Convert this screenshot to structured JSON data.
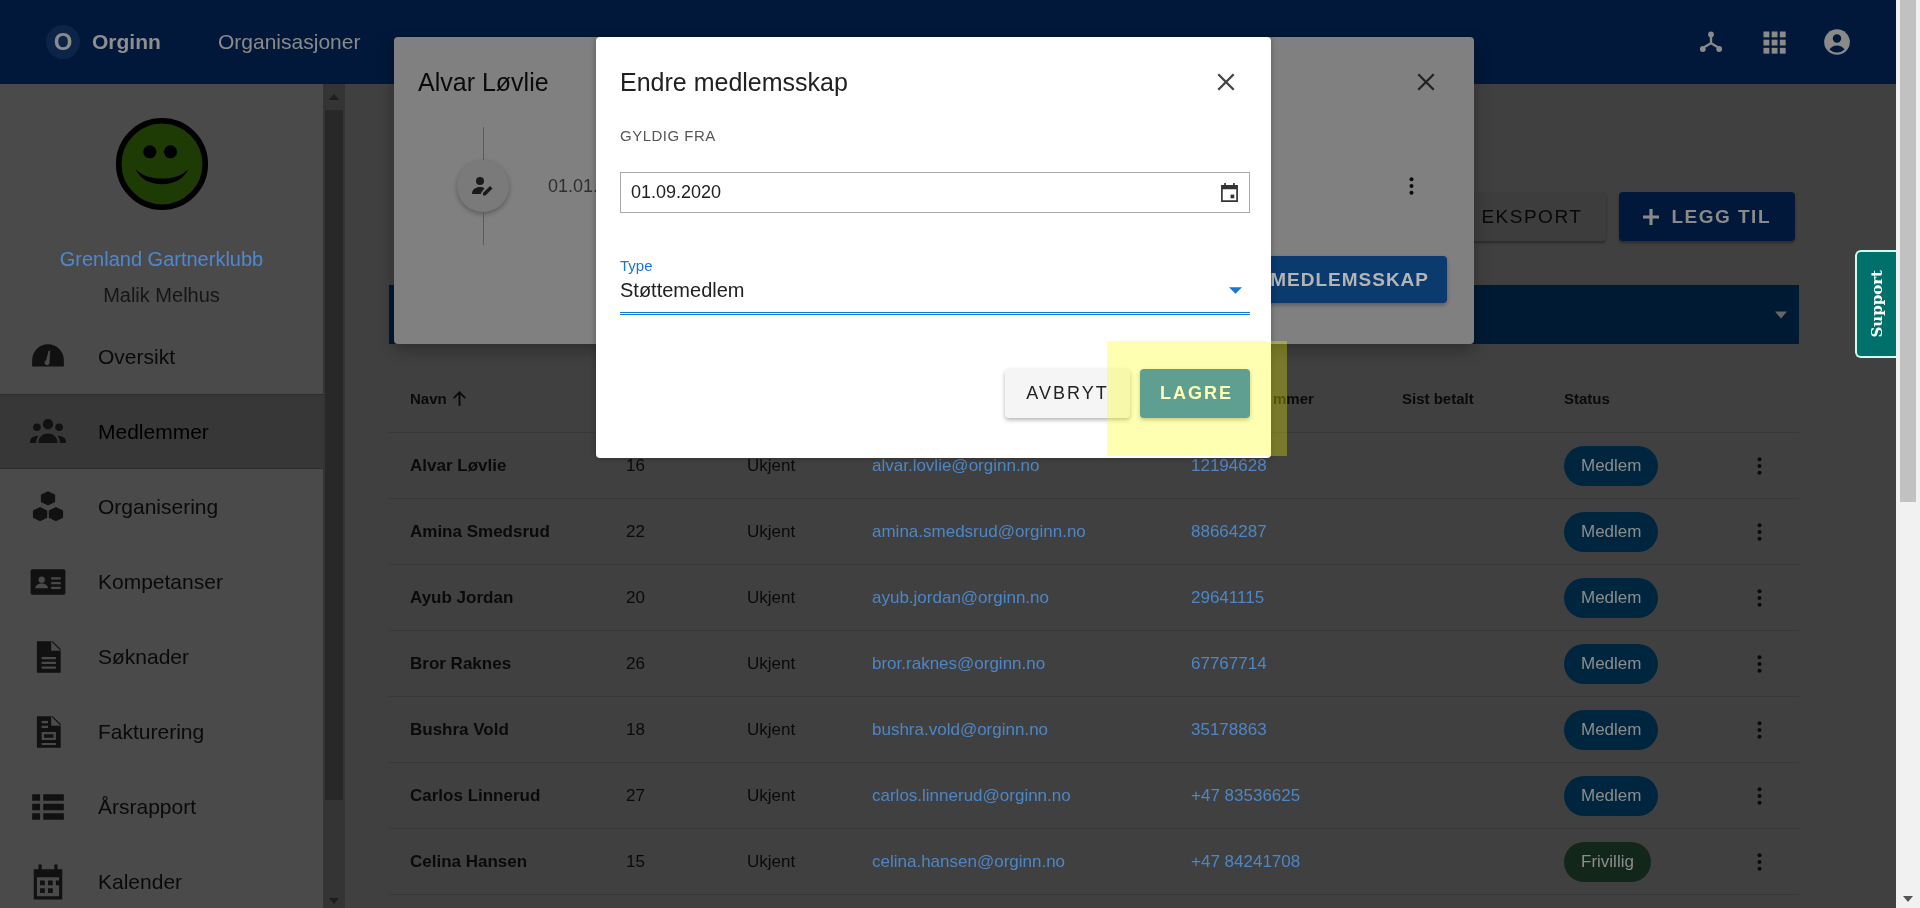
{
  "topbar": {
    "logo_letter": "O",
    "brand": "Orginn",
    "nav": [
      {
        "label": "Organisasjoner"
      }
    ]
  },
  "sidebar": {
    "organization": "Grenland Gartnerklubb",
    "user": "Malik Melhus",
    "items": [
      {
        "label": "Oversikt",
        "selected": false
      },
      {
        "label": "Medlemmer",
        "selected": true
      },
      {
        "label": "Organisering",
        "selected": false
      },
      {
        "label": "Kompetanser",
        "selected": false
      },
      {
        "label": "Søknader",
        "selected": false
      },
      {
        "label": "Fakturering",
        "selected": false
      },
      {
        "label": "Årsrapport",
        "selected": false
      },
      {
        "label": "Kalender",
        "selected": false
      }
    ]
  },
  "actions": [
    {
      "label": "EKSPORT",
      "kind": "plain"
    },
    {
      "label": "LEGG TIL",
      "kind": "add"
    }
  ],
  "table": {
    "columns": {
      "name": {
        "label": "Navn"
      },
      "phone": {
        "label": "mmer"
      },
      "paid": {
        "label": "Sist betalt"
      },
      "status": {
        "label": "Status"
      }
    },
    "rows": [
      {
        "name": "Alvar Løvlie",
        "column_2": "16",
        "column_3": "Ukjent",
        "email": "alvar.lovlie@orginn.no",
        "phone": "12194628",
        "status": {
          "label": "Medlem",
          "color": "#00263f"
        }
      },
      {
        "name": "Amina Smedsrud",
        "column_2": "22",
        "column_3": "Ukjent",
        "email": "amina.smedsrud@orginn.no",
        "phone": "88664287",
        "status": {
          "label": "Medlem",
          "color": "#00263f"
        }
      },
      {
        "name": "Ayub Jordan",
        "column_2": "20",
        "column_3": "Ukjent",
        "email": "ayub.jordan@orginn.no",
        "phone": "29641115",
        "status": {
          "label": "Medlem",
          "color": "#00263f"
        }
      },
      {
        "name": "Bror Raknes",
        "column_2": "26",
        "column_3": "Ukjent",
        "email": "bror.raknes@orginn.no",
        "phone": "67767714",
        "status": {
          "label": "Medlem",
          "color": "#00263f"
        }
      },
      {
        "name": "Bushra Vold",
        "column_2": "18",
        "column_3": "Ukjent",
        "email": "bushra.vold@orginn.no",
        "phone": "35178863",
        "status": {
          "label": "Medlem",
          "color": "#00263f"
        }
      },
      {
        "name": "Carlos Linnerud",
        "column_2": "27",
        "column_3": "Ukjent",
        "email": "carlos.linnerud@orginn.no",
        "phone": "+47 83536625",
        "status": {
          "label": "Medlem",
          "color": "#00263f"
        }
      },
      {
        "name": "Celina Hansen",
        "column_2": "15",
        "column_3": "Ukjent",
        "email": "celina.hansen@orginn.no",
        "phone": "+47 84241708",
        "status": {
          "label": "Frivillig",
          "color": "#13261a"
        }
      }
    ]
  },
  "member_dialog": {
    "title": "Alvar Løvlie",
    "timeline": [
      {
        "date": "01.01."
      }
    ],
    "action": "MEDLEMSSKAP"
  },
  "edit_dialog": {
    "title": "Endre medlemsskap",
    "section_label": "GYLDIG FRA",
    "date_field": {
      "value": "01.09.2020"
    },
    "type_field": {
      "label": "Type",
      "value": "Støttemedlem",
      "focused": true
    },
    "buttons": [
      {
        "label": "AVBRYT",
        "kind": "secondary",
        "highlighted": false
      },
      {
        "label": "LAGRE",
        "kind": "primary",
        "highlighted": true
      }
    ]
  },
  "support": {
    "label": "Support"
  }
}
